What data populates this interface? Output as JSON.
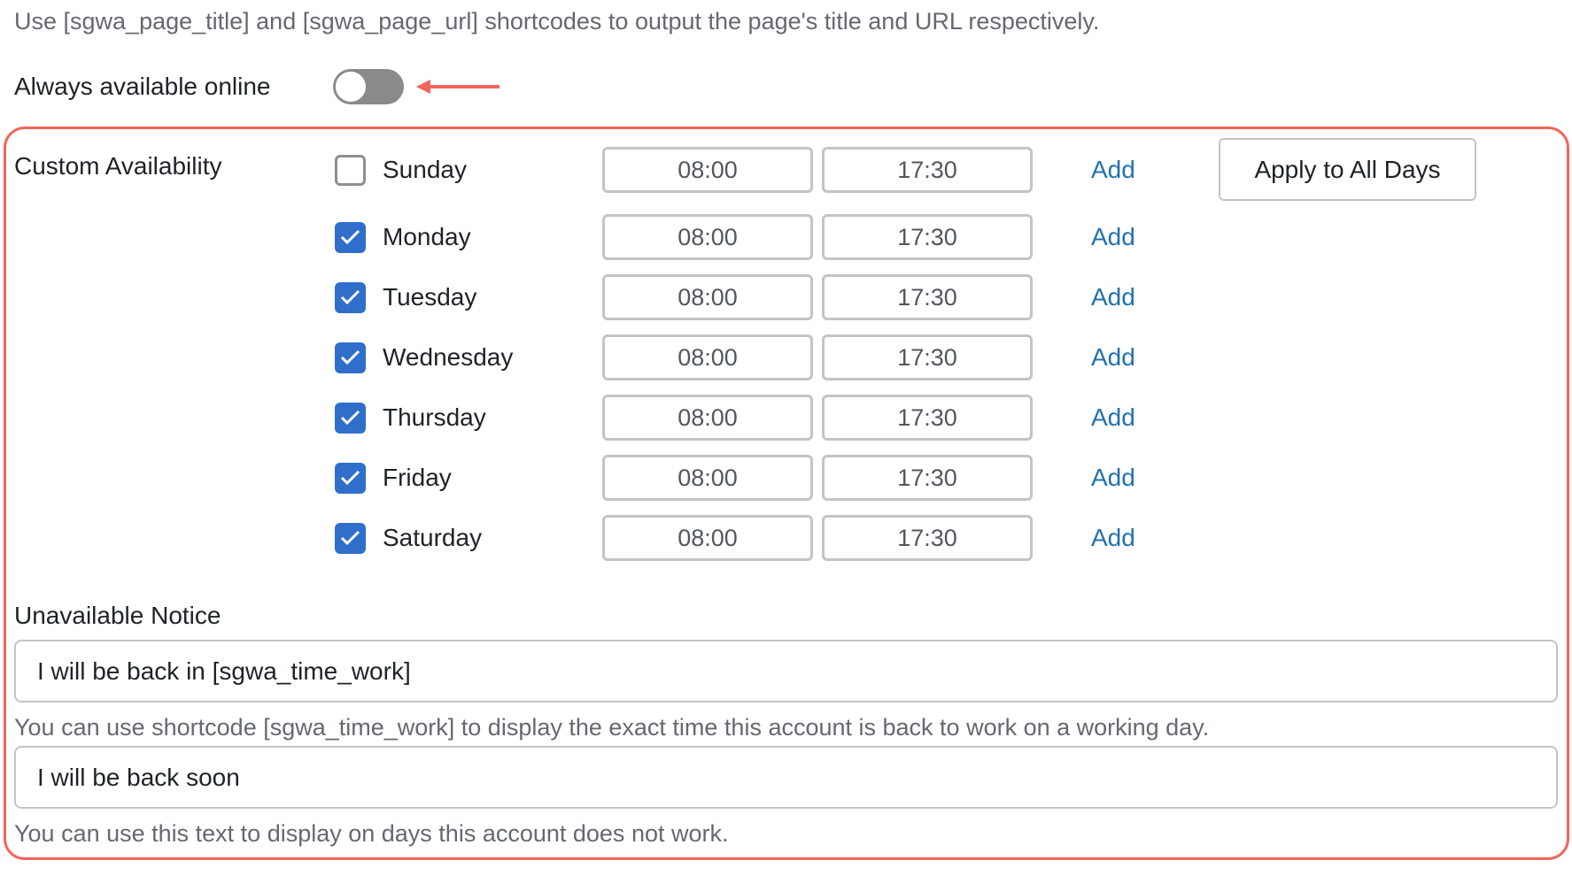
{
  "intro_description": "Use [sgwa_page_title] and [sgwa_page_url] shortcodes to output the page's title and URL respectively.",
  "always_online": {
    "label": "Always available online",
    "enabled": false,
    "annotation_arrow_color": "#f2665a"
  },
  "custom_availability": {
    "label": "Custom Availability",
    "apply_all_label": "Apply to All Days",
    "add_label": "Add",
    "days": [
      {
        "name": "Sunday",
        "checked": false,
        "start": "08:00",
        "end": "17:30"
      },
      {
        "name": "Monday",
        "checked": true,
        "start": "08:00",
        "end": "17:30"
      },
      {
        "name": "Tuesday",
        "checked": true,
        "start": "08:00",
        "end": "17:30"
      },
      {
        "name": "Wednesday",
        "checked": true,
        "start": "08:00",
        "end": "17:30"
      },
      {
        "name": "Thursday",
        "checked": true,
        "start": "08:00",
        "end": "17:30"
      },
      {
        "name": "Friday",
        "checked": true,
        "start": "08:00",
        "end": "17:30"
      },
      {
        "name": "Saturday",
        "checked": true,
        "start": "08:00",
        "end": "17:30"
      }
    ]
  },
  "unavailable_notice": {
    "label": "Unavailable Notice",
    "working_day_value": "I will be back in [sgwa_time_work]",
    "working_day_help": "You can use shortcode [sgwa_time_work] to display the exact time this account is back to work on a working day.",
    "off_day_value": "I will be back soon",
    "off_day_help": "You can use this text to display on days this account does not work."
  },
  "colors": {
    "accent": "#2f6fcb",
    "link": "#2271b1",
    "highlight": "#f2665a"
  }
}
